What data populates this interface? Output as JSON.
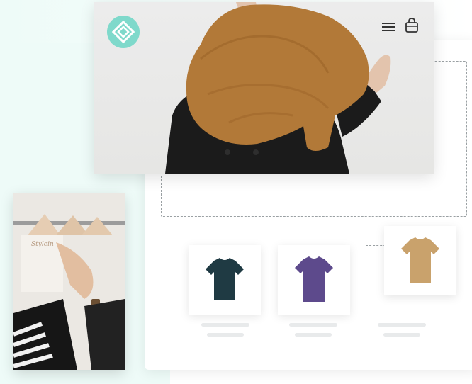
{
  "header": {
    "menu_icon": "hamburger-menu-icon",
    "cart_icon": "shopping-bag-icon",
    "logo_color": "#7fd9cb"
  },
  "hanger_photo": {
    "brand_text": "Stylein"
  },
  "products": [
    {
      "name": "tshirt-dark-teal",
      "color": "#1f3a43"
    },
    {
      "name": "tshirt-purple",
      "color": "#5d4a8c"
    },
    {
      "name": "tshirt-tan",
      "color": "#c9a26c"
    }
  ],
  "colors": {
    "mint_background": "#eefbf8",
    "scarf": "#b27938",
    "coat": "#1a1a1a",
    "dashed_border": "#9aa0a3"
  }
}
